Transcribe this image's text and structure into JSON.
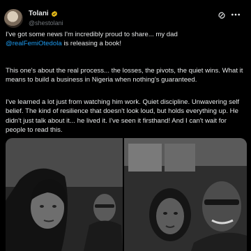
{
  "author": {
    "name": "Tolani",
    "handle": "@shestolani",
    "verified": true
  },
  "icons": {
    "avatar": "profile-photo",
    "verified": "verified-badge-icon",
    "grok": "grok-icon",
    "more": "more-options-icon"
  },
  "colors": {
    "background": "#000000",
    "text": "#e7e9ea",
    "secondary": "#71767b",
    "accent": "#1d9bf0",
    "verified_badge": "#e2b719"
  },
  "tweet": {
    "p1_before": "I've got some news I'm incredibly proud to share... my dad",
    "mention": "@realFemiOtedola",
    "p1_after": " is releasing a book!",
    "p2": "This one's about the real process... the losses, the pivots, the quiet wins. What it means to build a business in Nigeria when nothing's guaranteed.",
    "p3": "I've learned a lot just from watching him work. Quiet discipline. Unwavering self belief. The kind of resilience that doesn't look loud, but holds everything up. He didn't just talk about it... he lived it. I've seen it firsthand! And I can't wait for people to read this."
  },
  "media": {
    "count": 2
  }
}
